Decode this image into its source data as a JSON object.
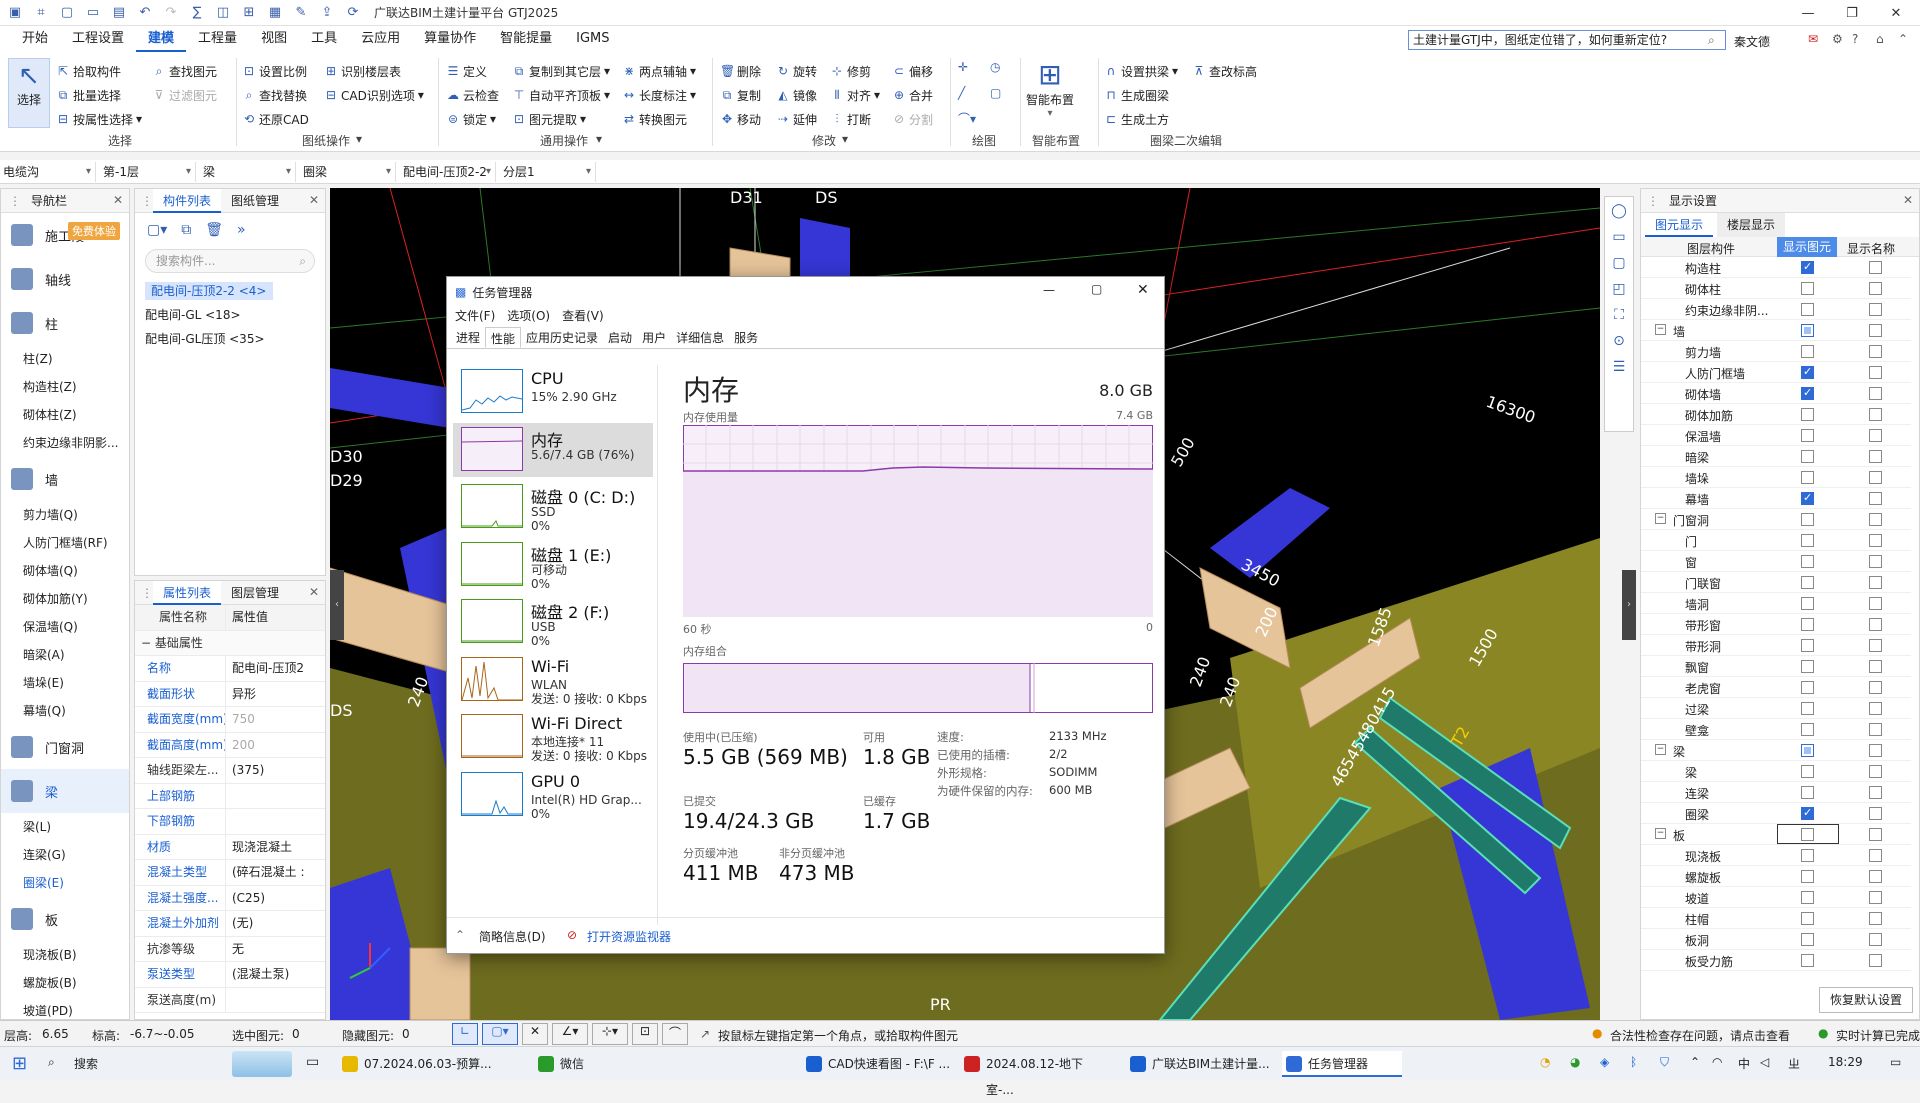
{
  "app": {
    "title": "广联达BIM土建计量平台 GTJ2025"
  },
  "menu": [
    "开始",
    "工程设置",
    "建模",
    "工程量",
    "视图",
    "工具",
    "云应用",
    "算量协作",
    "智能提量",
    "IGMS"
  ],
  "help": {
    "search": "土建计量GTJ中，图纸定位错了，如何重新定位?",
    "user": "秦文德"
  },
  "ribbon": {
    "select": "选择",
    "col1": [
      "拾取构件",
      "批量选择",
      "按属性选择"
    ],
    "col2": [
      "查找图元",
      "过滤图元"
    ],
    "g1": "选择",
    "col3": [
      "设置比例",
      "查找替换",
      "还原CAD"
    ],
    "col4": [
      "识别楼层表",
      "CAD识别选项"
    ],
    "g2": "图纸操作",
    "col5": [
      "定义",
      "云检查",
      "锁定"
    ],
    "col6": [
      "复制到其它层",
      "自动平齐顶板",
      "图元提取"
    ],
    "col7": [
      "两点辅轴",
      "长度标注",
      "转换图元"
    ],
    "g3": "通用操作",
    "col8": [
      "删除",
      "复制",
      "移动"
    ],
    "col9": [
      "旋转",
      "镜像",
      "延伸"
    ],
    "col10": [
      "修剪",
      "对齐",
      "打断"
    ],
    "col11": [
      "偏移",
      "合并",
      "分割"
    ],
    "g4": "修改",
    "g5": "绘图",
    "smart": "智能布置",
    "g6": "智能布置",
    "col12": [
      "设置拱梁",
      "生成圈梁",
      "生成土方"
    ],
    "col13": [
      "查改标高"
    ],
    "g7": "圈梁二次编辑"
  },
  "selectors": [
    "电缆沟",
    "第-1层",
    "梁",
    "圈梁",
    "配电间-压顶2-2",
    "分层1"
  ],
  "nav": {
    "title": "导航栏",
    "badge": "免费体验",
    "items": [
      {
        "type": "cat",
        "label": "施工段"
      },
      {
        "type": "cat",
        "label": "轴线"
      },
      {
        "type": "cat",
        "label": "柱"
      },
      {
        "type": "sub",
        "label": "柱(Z)"
      },
      {
        "type": "sub",
        "label": "构造柱(Z)"
      },
      {
        "type": "sub",
        "label": "砌体柱(Z)"
      },
      {
        "type": "sub",
        "label": "约束边缘非阴影..."
      },
      {
        "type": "cat",
        "label": "墙"
      },
      {
        "type": "sub",
        "label": "剪力墙(Q)"
      },
      {
        "type": "sub",
        "label": "人防门框墙(RF)"
      },
      {
        "type": "sub",
        "label": "砌体墙(Q)"
      },
      {
        "type": "sub",
        "label": "砌体加筋(Y)"
      },
      {
        "type": "sub",
        "label": "保温墙(Q)"
      },
      {
        "type": "sub",
        "label": "暗梁(A)"
      },
      {
        "type": "sub",
        "label": "墙垛(E)"
      },
      {
        "type": "sub",
        "label": "幕墙(Q)"
      },
      {
        "type": "cat",
        "label": "门窗洞"
      },
      {
        "type": "cat",
        "label": "梁",
        "on": true
      },
      {
        "type": "sub",
        "label": "梁(L)"
      },
      {
        "type": "sub",
        "label": "连梁(G)"
      },
      {
        "type": "sub",
        "label": "圈梁(E)",
        "on": true
      },
      {
        "type": "cat",
        "label": "板"
      },
      {
        "type": "sub",
        "label": "现浇板(B)"
      },
      {
        "type": "sub",
        "label": "螺旋板(B)"
      },
      {
        "type": "sub",
        "label": "坡道(PD)"
      }
    ]
  },
  "complist": {
    "tabs": [
      "构件列表",
      "图纸管理"
    ],
    "search": "搜索构件...",
    "items": [
      "配电间-压顶2-2 <4>",
      "配电间-GL <18>",
      "配电间-GL压顶 <35>"
    ]
  },
  "props": {
    "tabs": [
      "属性列表",
      "图层管理"
    ],
    "h1": "属性名称",
    "h2": "属性值",
    "group": "基础属性",
    "rows": [
      {
        "n": "名称",
        "v": "配电间-压顶2",
        "blue": true
      },
      {
        "n": "截面形状",
        "v": "异形",
        "blue": true
      },
      {
        "n": "截面宽度(mm)",
        "v": "750",
        "blue": true,
        "gray": true
      },
      {
        "n": "截面高度(mm)",
        "v": "200",
        "blue": true,
        "gray": true
      },
      {
        "n": "轴线距梁左...",
        "v": "(375)",
        "blue": false
      },
      {
        "n": "上部钢筋",
        "v": "",
        "blue": true
      },
      {
        "n": "下部钢筋",
        "v": "",
        "blue": true
      },
      {
        "n": "材质",
        "v": "现浇混凝土",
        "blue": true
      },
      {
        "n": "混凝土类型",
        "v": "(碎石混凝土 :",
        "blue": true
      },
      {
        "n": "混凝土强度...",
        "v": "(C25)",
        "blue": true
      },
      {
        "n": "混凝土外加剂",
        "v": "(无)",
        "blue": true
      },
      {
        "n": "抗渗等级",
        "v": "无",
        "blue": false
      },
      {
        "n": "泵送类型",
        "v": "(混凝土泵)",
        "blue": true
      },
      {
        "n": "泵送高度(m)",
        "v": "",
        "blue": false
      }
    ]
  },
  "canvas": {
    "labels": [
      "D31",
      "DS",
      "D30",
      "D29",
      "DS",
      "16300",
      "3450",
      "1585",
      "1500",
      "500",
      "240",
      "240",
      "240",
      "200",
      "PR",
      "46545480415",
      "T2"
    ]
  },
  "tm": {
    "title": "任务管理器",
    "menus": [
      "文件(F)",
      "选项(O)",
      "查看(V)"
    ],
    "tabs": [
      "进程",
      "性能",
      "应用历史记录",
      "启动",
      "用户",
      "详细信息",
      "服务"
    ],
    "side": [
      {
        "name": "CPU",
        "sub1": "15% 2.90 GHz",
        "sub2": "",
        "color": "#1a7ac8"
      },
      {
        "name": "内存",
        "sub1": "5.6/7.4 GB (76%)",
        "sub2": "",
        "color": "#8b3aa8"
      },
      {
        "name": "磁盘 0 (C: D:)",
        "sub1": "SSD",
        "sub2": "0%",
        "color": "#4a9a1a"
      },
      {
        "name": "磁盘 1 (E:)",
        "sub1": "可移动",
        "sub2": "0%",
        "color": "#4a9a1a"
      },
      {
        "name": "磁盘 2 (F:)",
        "sub1": "USB",
        "sub2": "0%",
        "color": "#4a9a1a"
      },
      {
        "name": "Wi-Fi",
        "sub1": "WLAN",
        "sub2": "发送: 0 接收: 0 Kbps",
        "color": "#a8641a"
      },
      {
        "name": "Wi-Fi Direct",
        "sub1": "本地连接* 11",
        "sub2": "发送: 0 接收: 0 Kbps",
        "color": "#a8641a"
      },
      {
        "name": "GPU 0",
        "sub1": "Intel(R) HD Grap...",
        "sub2": "0%",
        "color": "#1a7ac8"
      }
    ],
    "main": {
      "title": "内存",
      "total": "8.0 GB",
      "usage_lbl": "内存使用量",
      "usage_max": "7.4 GB",
      "t60": "60 秒",
      "t0": "0",
      "comp": "内存组合",
      "inuse_l": "使用中(已压缩)",
      "inuse_v": "5.5 GB (569 MB)",
      "avail_l": "可用",
      "avail_v": "1.8 GB",
      "commit_l": "已提交",
      "commit_v": "19.4/24.3 GB",
      "cached_l": "已缓存",
      "cached_v": "1.7 GB",
      "paged_l": "分页缓冲池",
      "paged_v": "411 MB",
      "nonpaged_l": "非分页缓冲池",
      "nonpaged_v": "473 MB",
      "speed_l": "速度:",
      "speed_v": "2133 MHz",
      "slots_l": "已使用的插槽:",
      "slots_v": "2/2",
      "form_l": "外形规格:",
      "form_v": "SODIMM",
      "res_l": "为硬件保留的内存:",
      "res_v": "600 MB"
    },
    "footer": {
      "brief": "简略信息(D)",
      "monitor": "打开资源监视器"
    }
  },
  "display": {
    "title": "显示设置",
    "tabs": [
      "图元显示",
      "楼层显示"
    ],
    "h1": "图层构件",
    "h2": "显示图元",
    "h3": "显示名称",
    "rows": [
      {
        "l": "构造柱",
        "a": "on",
        "b": "off",
        "g": false
      },
      {
        "l": "砌体柱",
        "a": "off",
        "b": "off",
        "g": false
      },
      {
        "l": "约束边缘非阴...",
        "a": "off",
        "b": "off",
        "g": false
      },
      {
        "l": "墙",
        "a": "mid",
        "b": "off",
        "g": true
      },
      {
        "l": "剪力墙",
        "a": "off",
        "b": "off",
        "g": false
      },
      {
        "l": "人防门框墙",
        "a": "on",
        "b": "off",
        "g": false
      },
      {
        "l": "砌体墙",
        "a": "on",
        "b": "off",
        "g": false
      },
      {
        "l": "砌体加筋",
        "a": "off",
        "b": "off",
        "g": false
      },
      {
        "l": "保温墙",
        "a": "off",
        "b": "off",
        "g": false
      },
      {
        "l": "暗梁",
        "a": "off",
        "b": "off",
        "g": false
      },
      {
        "l": "墙垛",
        "a": "off",
        "b": "off",
        "g": false
      },
      {
        "l": "幕墙",
        "a": "on",
        "b": "off",
        "g": false
      },
      {
        "l": "门窗洞",
        "a": "off",
        "b": "off",
        "g": true
      },
      {
        "l": "门",
        "a": "off",
        "b": "off",
        "g": false
      },
      {
        "l": "窗",
        "a": "off",
        "b": "off",
        "g": false
      },
      {
        "l": "门联窗",
        "a": "off",
        "b": "off",
        "g": false
      },
      {
        "l": "墙洞",
        "a": "off",
        "b": "off",
        "g": false
      },
      {
        "l": "带形窗",
        "a": "off",
        "b": "off",
        "g": false
      },
      {
        "l": "带形洞",
        "a": "off",
        "b": "off",
        "g": false
      },
      {
        "l": "飘窗",
        "a": "off",
        "b": "off",
        "g": false
      },
      {
        "l": "老虎窗",
        "a": "off",
        "b": "off",
        "g": false
      },
      {
        "l": "过梁",
        "a": "off",
        "b": "off",
        "g": false
      },
      {
        "l": "壁龛",
        "a": "off",
        "b": "off",
        "g": false
      },
      {
        "l": "梁",
        "a": "mid",
        "b": "off",
        "g": true
      },
      {
        "l": "梁",
        "a": "off",
        "b": "off",
        "g": false
      },
      {
        "l": "连梁",
        "a": "off",
        "b": "off",
        "g": false
      },
      {
        "l": "圈梁",
        "a": "on",
        "b": "off",
        "g": false
      },
      {
        "l": "板",
        "a": "off",
        "b": "off",
        "g": true
      },
      {
        "l": "现浇板",
        "a": "off",
        "b": "off",
        "g": false
      },
      {
        "l": "螺旋板",
        "a": "off",
        "b": "off",
        "g": false
      },
      {
        "l": "坡道",
        "a": "off",
        "b": "off",
        "g": false
      },
      {
        "l": "柱帽",
        "a": "off",
        "b": "off",
        "g": false
      },
      {
        "l": "板洞",
        "a": "off",
        "b": "off",
        "g": false
      },
      {
        "l": "板受力筋",
        "a": "off",
        "b": "off",
        "g": false
      }
    ],
    "reset": "恢复默认设置"
  },
  "status": {
    "floor_l": "层高:",
    "floor_v": "6.65",
    "elev_l": "标高:",
    "elev_v": "-6.7~-0.05",
    "sel_l": "选中图元:",
    "sel_v": "0",
    "hid_l": "隐藏图元:",
    "hid_v": "0",
    "hint": "按鼠标左键指定第一个角点，或拾取构件图元",
    "check": "合法性检查存在问题，请点击查看",
    "calc": "实时计算已完成"
  },
  "taskbar": {
    "search": "搜索",
    "items": [
      "07.2024.06.03-预算...",
      "微信",
      "CAD快速看图 - F:\\F ...",
      "2024.08.12-地下室-...",
      "广联达BIM土建计量...",
      "任务管理器"
    ],
    "lang": "中",
    "input": "ㄓ",
    "time": "18:29"
  }
}
